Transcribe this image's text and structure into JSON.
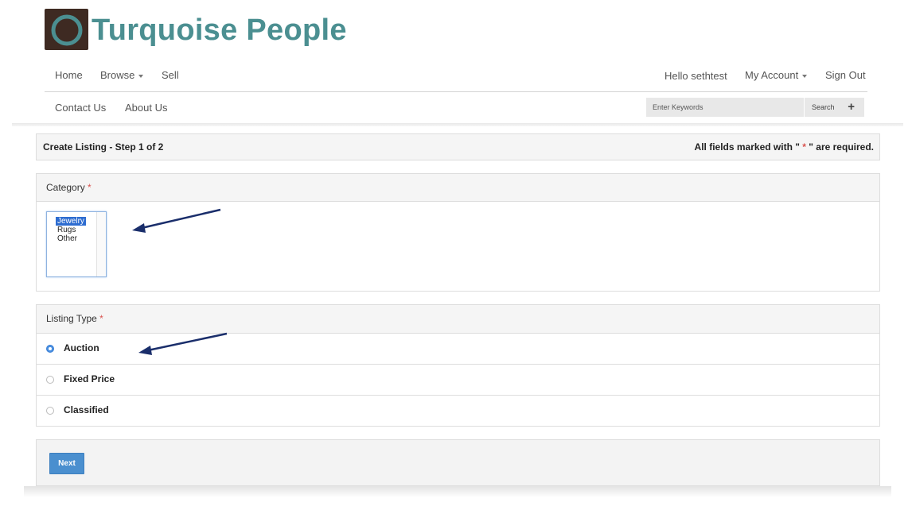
{
  "brand": {
    "name": "Turquoise People",
    "logo_icon": "ring-logo-icon",
    "colors": {
      "brand": "#4b8f91",
      "logo_bg": "#3e2a22",
      "accent": "#4a8fcf",
      "required": "#d9534f",
      "annotation_arrow": "#1a2e6b"
    }
  },
  "nav": {
    "home": "Home",
    "browse": "Browse",
    "sell": "Sell",
    "greeting": "Hello sethtest",
    "my_account": "My Account",
    "sign_out": "Sign Out",
    "contact_us": "Contact Us",
    "about_us": "About Us"
  },
  "search": {
    "placeholder": "Enter Keywords",
    "button_label": "Search",
    "plus_icon": "+"
  },
  "form": {
    "title": "Create Listing - Step 1 of 2",
    "required_prefix": "All fields marked with \"",
    "required_star": " * ",
    "required_suffix": "\" are required.",
    "category": {
      "label": "Category",
      "required_mark": "*",
      "options": [
        "Jewelry",
        "Rugs",
        "Other"
      ],
      "selected": "Jewelry"
    },
    "listing_type": {
      "label": "Listing Type",
      "required_mark": "*",
      "options": [
        "Auction",
        "Fixed Price",
        "Classified"
      ],
      "selected": "Auction"
    },
    "next_label": "Next"
  }
}
